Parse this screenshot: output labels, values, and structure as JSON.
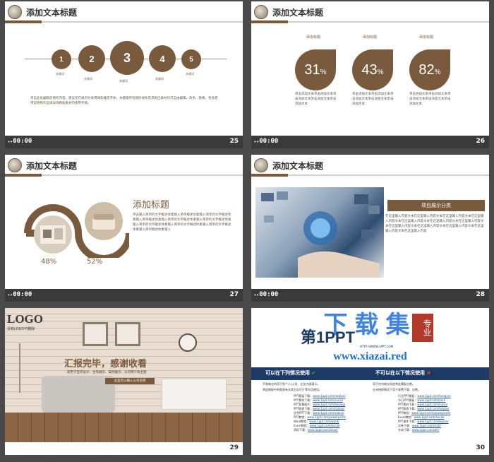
{
  "header_title": "添加文本标题",
  "time": "00:00",
  "slide25": {
    "number": "25",
    "steps": [
      {
        "n": "1",
        "label": "关键词"
      },
      {
        "n": "2",
        "label": "关键词"
      },
      {
        "n": "3",
        "label": "关键词"
      },
      {
        "n": "4",
        "label": "关键词"
      },
      {
        "n": "5",
        "label": "关键词"
      }
    ],
    "body": "单击此处编辑您要的内容，建议您在展示时采用微软雅黑字体，本模版所有图形线条及其相应素材均可自由编辑、改色、替换。更多使用说明和作品请详询模板素材的使用手册。"
  },
  "slide26": {
    "number": "26",
    "columns": [
      {
        "title": "添加标题",
        "value": "31",
        "unit": "%",
        "text": "单击添加文本单击添加文本单击添加文本单击添加文本单击添加文本"
      },
      {
        "title": "添加标题",
        "value": "43",
        "unit": "%",
        "text": "单击添加文本单击添加文本单击添加文本单击添加文本单击添加文本"
      },
      {
        "title": "添加标题",
        "value": "82",
        "unit": "%",
        "text": "单击添加文本单击添加文本单击添加文本单击添加文本单击添加文本"
      }
    ]
  },
  "slide27": {
    "number": "27",
    "heading": "添加标题",
    "pct_left": "48%",
    "pct_right": "52%",
    "body": "单击输入简单的文字概述体素输入简单概述体素输入简单的文字概述体素输入简单概述体素输入简单的文字概述体素输入简单的文字概述体素输入简单的文字概述体素输入简单的文字概述体素输入简单的文字概述体素输入简单概述体素输入"
  },
  "slide28": {
    "number": "28",
    "tag": "项目展示分类",
    "body": "在这里输入内容文本在这里输入内容文本在这里输入内容文本在这里输入内容文本在这里输入内容文本在这里输入内容文本在这里输入内容文本在这里输入内容文本在这里输入内容文本在这里输入内容文本在这里输入内容文本在这里输入内容"
  },
  "slide29": {
    "number": "29",
    "logo": "LOGO",
    "logo_sub": "没有LOGO可删除",
    "title": "汇报完毕，感谢收看",
    "sub": "适用于室内设计、合作展示、案例展示、公司简介等主题",
    "btn": "这里可以输入公司名称"
  },
  "slide30": {
    "number": "30",
    "brand_a": "第1",
    "brand_b": "PPT",
    "url_small": "HTTP://WWW.1PPT.COM",
    "watermark": "下载集",
    "watermark_seal": "专业",
    "watermark_url": "www.xiazai.red",
    "can_title": "可以在下列情况使用",
    "cannot_title": "不可以在以下情况使用",
    "can_items": [
      "不限商业的用于您个人/公司、企业内部演示。",
      "将此模板中的图表有关其它幻灯片等作品使用。"
    ],
    "cannot_items": [
      "用于任何商业用途将此模板出售。",
      "在未授权情况下用于收费下载、出售。"
    ],
    "links_left": [
      [
        "PPT模板下载：",
        "www.1ppt.com/moban/"
      ],
      [
        "PPT素材下载：",
        "www.1ppt.com/sucai/"
      ],
      [
        "PPT背景图片：",
        "www.1ppt.com/beijing/"
      ],
      [
        "PPT图表下载：",
        "www.1ppt.com/tubiao/"
      ],
      [
        "优秀PPT下载：",
        "www.1ppt.com/xiazai/"
      ],
      [
        "PPT教程：",
        "www.1ppt.com/powerpoint/"
      ],
      [
        "Word教程：",
        "www.1ppt.com/word/"
      ],
      [
        "Excel教程：",
        "www.1ppt.com/excel/"
      ],
      [
        "资料下载：",
        "www.1ppt.com/ziliao/"
      ]
    ],
    "links_right": [
      [
        "行业PPT模板：",
        "www.1ppt.com/hangye/"
      ],
      [
        "节日PPT模板：",
        "www.1ppt.com/jieri/"
      ],
      [
        "PPT素材下载：",
        "www.1ppt.com/sucai/"
      ],
      [
        "PPT图表下载：",
        "www.1ppt.com/tubiao/"
      ],
      [
        "PPT教程：",
        "www.1ppt.com/powerpoint/"
      ],
      [
        "Excel教程：",
        "www.1ppt.com/excel/"
      ],
      [
        "PPT课件下载：",
        "www.1ppt.com/kejian/"
      ],
      [
        "试卷下载：",
        "www.1ppt.com/shiti/"
      ],
      [
        "字体下载：",
        "www.1ppt.com/ziti/"
      ]
    ]
  },
  "colors": {
    "brown": "#7a5a3c",
    "navy": "#1b3a66"
  }
}
